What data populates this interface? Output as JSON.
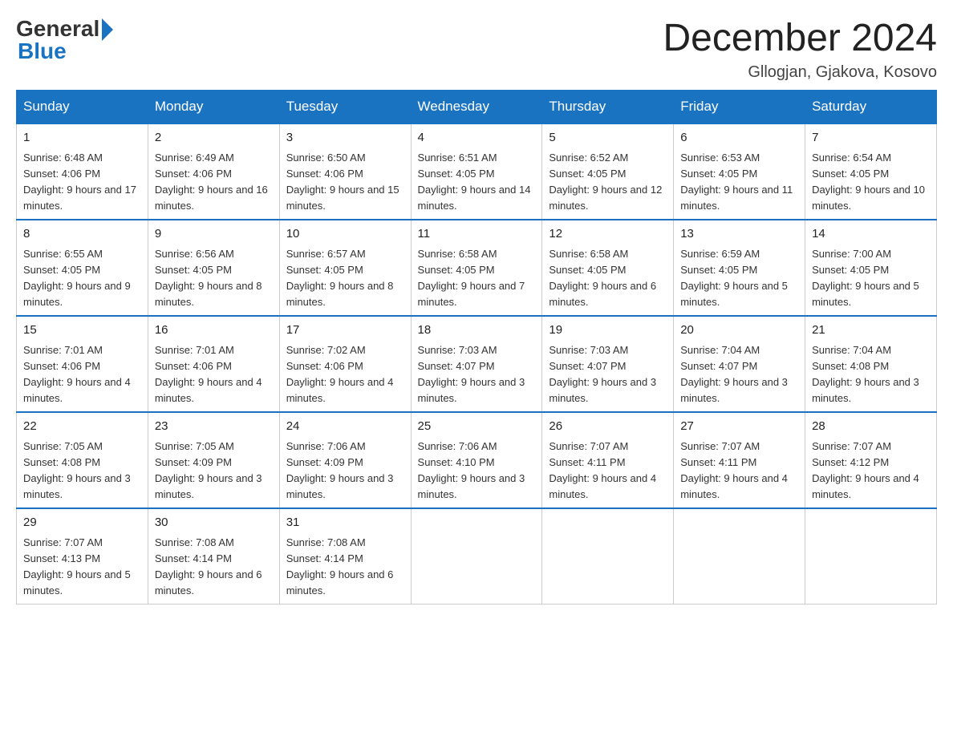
{
  "header": {
    "logo_general": "General",
    "logo_blue": "Blue",
    "title": "December 2024",
    "location": "Gllogjan, Gjakova, Kosovo"
  },
  "calendar": {
    "days_of_week": [
      "Sunday",
      "Monday",
      "Tuesday",
      "Wednesday",
      "Thursday",
      "Friday",
      "Saturday"
    ],
    "weeks": [
      [
        {
          "day": "1",
          "sunrise": "6:48 AM",
          "sunset": "4:06 PM",
          "daylight": "9 hours and 17 minutes."
        },
        {
          "day": "2",
          "sunrise": "6:49 AM",
          "sunset": "4:06 PM",
          "daylight": "9 hours and 16 minutes."
        },
        {
          "day": "3",
          "sunrise": "6:50 AM",
          "sunset": "4:06 PM",
          "daylight": "9 hours and 15 minutes."
        },
        {
          "day": "4",
          "sunrise": "6:51 AM",
          "sunset": "4:05 PM",
          "daylight": "9 hours and 14 minutes."
        },
        {
          "day": "5",
          "sunrise": "6:52 AM",
          "sunset": "4:05 PM",
          "daylight": "9 hours and 12 minutes."
        },
        {
          "day": "6",
          "sunrise": "6:53 AM",
          "sunset": "4:05 PM",
          "daylight": "9 hours and 11 minutes."
        },
        {
          "day": "7",
          "sunrise": "6:54 AM",
          "sunset": "4:05 PM",
          "daylight": "9 hours and 10 minutes."
        }
      ],
      [
        {
          "day": "8",
          "sunrise": "6:55 AM",
          "sunset": "4:05 PM",
          "daylight": "9 hours and 9 minutes."
        },
        {
          "day": "9",
          "sunrise": "6:56 AM",
          "sunset": "4:05 PM",
          "daylight": "9 hours and 8 minutes."
        },
        {
          "day": "10",
          "sunrise": "6:57 AM",
          "sunset": "4:05 PM",
          "daylight": "9 hours and 8 minutes."
        },
        {
          "day": "11",
          "sunrise": "6:58 AM",
          "sunset": "4:05 PM",
          "daylight": "9 hours and 7 minutes."
        },
        {
          "day": "12",
          "sunrise": "6:58 AM",
          "sunset": "4:05 PM",
          "daylight": "9 hours and 6 minutes."
        },
        {
          "day": "13",
          "sunrise": "6:59 AM",
          "sunset": "4:05 PM",
          "daylight": "9 hours and 5 minutes."
        },
        {
          "day": "14",
          "sunrise": "7:00 AM",
          "sunset": "4:05 PM",
          "daylight": "9 hours and 5 minutes."
        }
      ],
      [
        {
          "day": "15",
          "sunrise": "7:01 AM",
          "sunset": "4:06 PM",
          "daylight": "9 hours and 4 minutes."
        },
        {
          "day": "16",
          "sunrise": "7:01 AM",
          "sunset": "4:06 PM",
          "daylight": "9 hours and 4 minutes."
        },
        {
          "day": "17",
          "sunrise": "7:02 AM",
          "sunset": "4:06 PM",
          "daylight": "9 hours and 4 minutes."
        },
        {
          "day": "18",
          "sunrise": "7:03 AM",
          "sunset": "4:07 PM",
          "daylight": "9 hours and 3 minutes."
        },
        {
          "day": "19",
          "sunrise": "7:03 AM",
          "sunset": "4:07 PM",
          "daylight": "9 hours and 3 minutes."
        },
        {
          "day": "20",
          "sunrise": "7:04 AM",
          "sunset": "4:07 PM",
          "daylight": "9 hours and 3 minutes."
        },
        {
          "day": "21",
          "sunrise": "7:04 AM",
          "sunset": "4:08 PM",
          "daylight": "9 hours and 3 minutes."
        }
      ],
      [
        {
          "day": "22",
          "sunrise": "7:05 AM",
          "sunset": "4:08 PM",
          "daylight": "9 hours and 3 minutes."
        },
        {
          "day": "23",
          "sunrise": "7:05 AM",
          "sunset": "4:09 PM",
          "daylight": "9 hours and 3 minutes."
        },
        {
          "day": "24",
          "sunrise": "7:06 AM",
          "sunset": "4:09 PM",
          "daylight": "9 hours and 3 minutes."
        },
        {
          "day": "25",
          "sunrise": "7:06 AM",
          "sunset": "4:10 PM",
          "daylight": "9 hours and 3 minutes."
        },
        {
          "day": "26",
          "sunrise": "7:07 AM",
          "sunset": "4:11 PM",
          "daylight": "9 hours and 4 minutes."
        },
        {
          "day": "27",
          "sunrise": "7:07 AM",
          "sunset": "4:11 PM",
          "daylight": "9 hours and 4 minutes."
        },
        {
          "day": "28",
          "sunrise": "7:07 AM",
          "sunset": "4:12 PM",
          "daylight": "9 hours and 4 minutes."
        }
      ],
      [
        {
          "day": "29",
          "sunrise": "7:07 AM",
          "sunset": "4:13 PM",
          "daylight": "9 hours and 5 minutes."
        },
        {
          "day": "30",
          "sunrise": "7:08 AM",
          "sunset": "4:14 PM",
          "daylight": "9 hours and 6 minutes."
        },
        {
          "day": "31",
          "sunrise": "7:08 AM",
          "sunset": "4:14 PM",
          "daylight": "9 hours and 6 minutes."
        },
        null,
        null,
        null,
        null
      ]
    ]
  }
}
